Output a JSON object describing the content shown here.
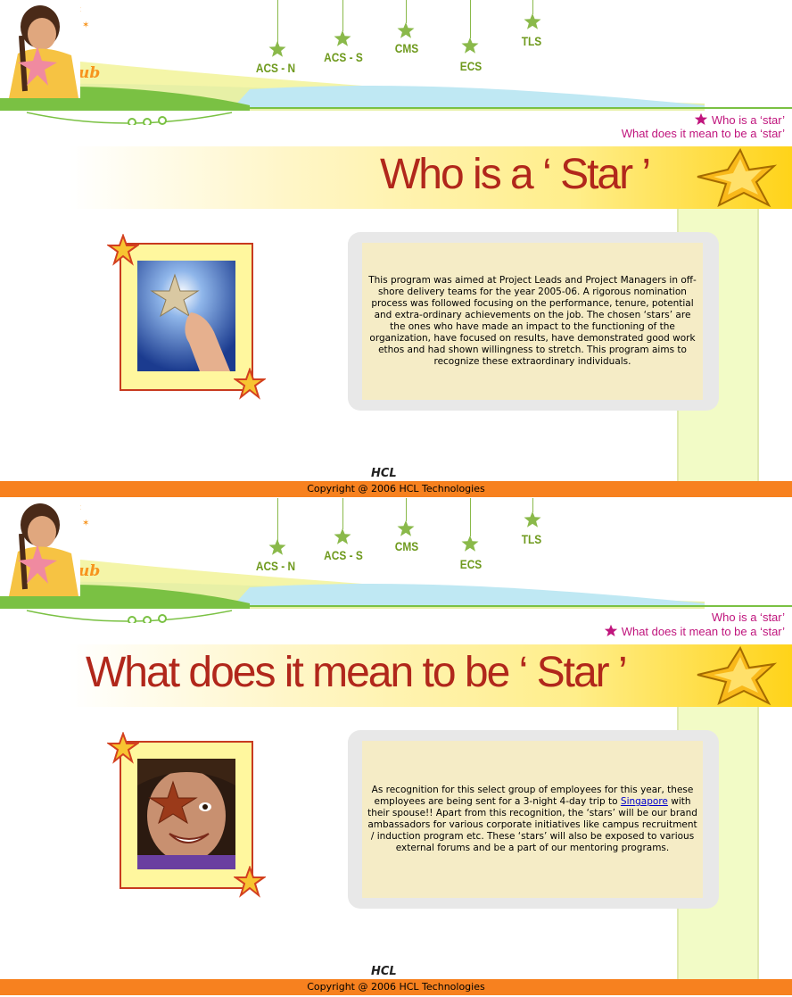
{
  "brand": {
    "logo_text": "Star Club",
    "footer_logo": "HCL"
  },
  "nav": {
    "items": [
      {
        "label": "ACS - N"
      },
      {
        "label": "ACS - S"
      },
      {
        "label": "CMS"
      },
      {
        "label": "ECS"
      },
      {
        "label": "TLS"
      }
    ]
  },
  "quick_links": {
    "who": "Who is a ‘star’",
    "what": "What does it mean to be a ‘star’"
  },
  "pages": [
    {
      "banner_title": "Who is a ‘ Star ’",
      "active_link": "who",
      "paragraph": "This program was aimed at Project Leads and Project Managers in off-shore delivery teams for the year 2005-06. A rigorous nomination process was followed focusing on the performance, tenure, potential and extra-ordinary achievements on the job. The chosen ‘stars’ are the ones who have made an impact to the functioning of the organization, have focused on results, have demonstrated good work ethos and had shown willingness to stretch. This program aims to recognize these extraordinary individuals."
    },
    {
      "banner_title": "What does it mean to be ‘ Star ’",
      "active_link": "what",
      "paragraph_before_link": "As recognition for this select group of employees for this year, these employees are being sent for a 3-night 4-day trip to ",
      "link_text": "Singapore",
      "paragraph_after_link": " with their spouse!! Apart from this recognition, the ‘stars’ will be our brand ambassadors for various corporate initiatives like campus recruitment / induction program etc. These ‘stars’ will also be exposed to various external forums and be a part of our mentoring programs."
    }
  ],
  "footer": {
    "copyright": "Copyright @ 2006 HCL Technologies"
  },
  "colors": {
    "accent_green": "#8ab94a",
    "link_magenta": "#c0157d",
    "footer_orange": "#f7811f",
    "banner_red": "#b1271b"
  }
}
